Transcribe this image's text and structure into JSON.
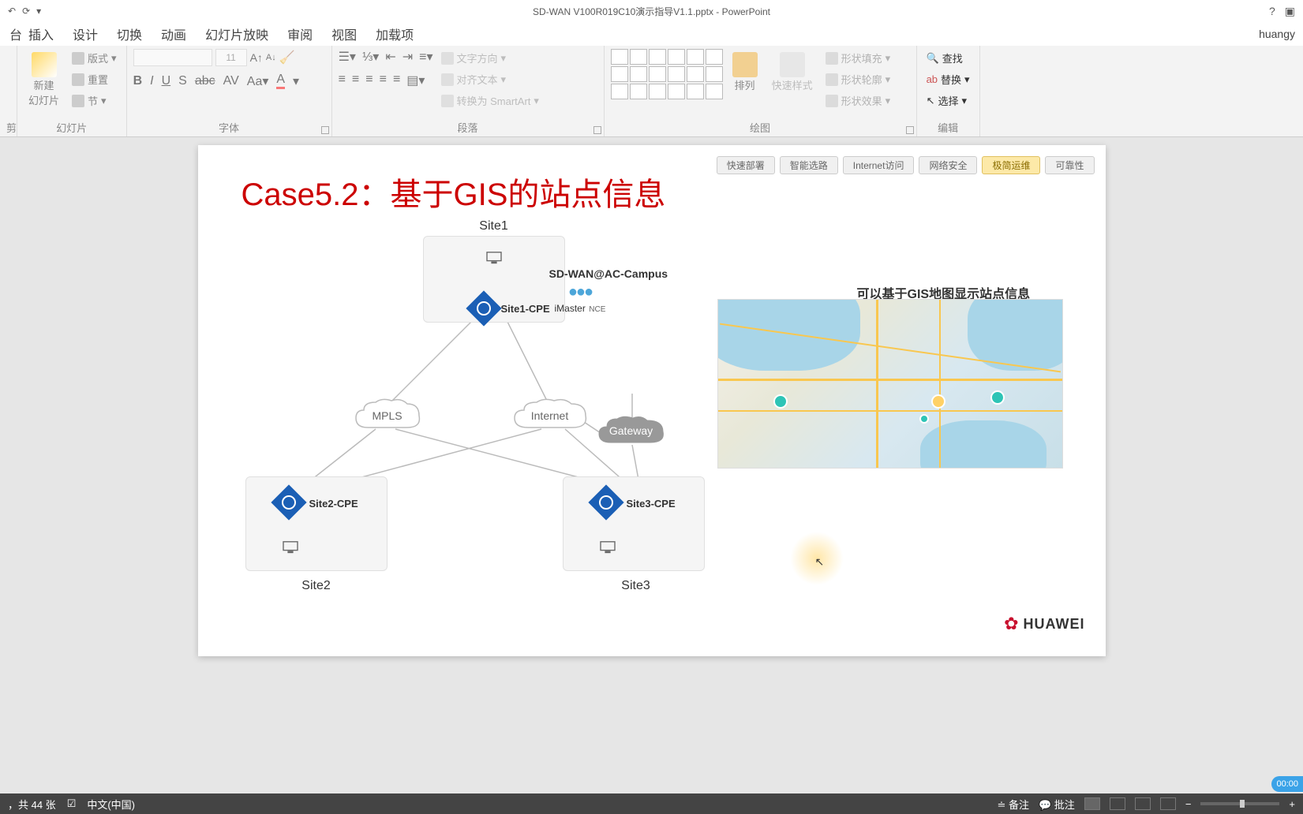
{
  "title_bar": {
    "document_title": "SD-WAN V100R019C10演示指导V1.1.pptx - PowerPoint",
    "help_icon": "?"
  },
  "ribbon_tabs": {
    "start_edge": "台",
    "items": [
      "插入",
      "设计",
      "切换",
      "动画",
      "幻灯片放映",
      "审阅",
      "视图",
      "加载项"
    ],
    "user": "huangy"
  },
  "ribbon": {
    "clipboard": {
      "label": "剪"
    },
    "slides": {
      "new_slide": "新建\n幻灯片",
      "layout": "版式",
      "reset": "重置",
      "section": "节",
      "group_label": "幻灯片"
    },
    "font": {
      "size_value": "11",
      "buttons": [
        "B",
        "I",
        "U",
        "S"
      ],
      "group_label": "字体"
    },
    "paragraph": {
      "text_direction": "文字方向",
      "align_text": "对齐文本",
      "convert_smartart": "转换为 SmartArt",
      "group_label": "段落"
    },
    "drawing": {
      "arrange": "排列",
      "quick_styles": "快速样式",
      "shape_fill": "形状填充",
      "shape_outline": "形状轮廓",
      "shape_effects": "形状效果",
      "group_label": "绘图"
    },
    "editing": {
      "find": "查找",
      "replace": "替换",
      "select": "选择",
      "group_label": "编辑"
    }
  },
  "slide": {
    "title": "Case5.2：基于GIS的站点信息",
    "nav_pills": [
      {
        "label": "快速部署",
        "active": false
      },
      {
        "label": "智能选路",
        "active": false
      },
      {
        "label": "Internet访问",
        "active": false
      },
      {
        "label": "网络安全",
        "active": false
      },
      {
        "label": "极简运维",
        "active": true
      },
      {
        "label": "可靠性",
        "active": false
      }
    ],
    "diagram": {
      "site1_label": "Site1",
      "site2_label": "Site2",
      "site3_label": "Site3",
      "site1_cpe": "Site1-CPE",
      "site2_cpe": "Site2-CPE",
      "site3_cpe": "Site3-CPE",
      "mpls": "MPLS",
      "internet": "Internet",
      "gateway": "Gateway",
      "sdwan_label": "SD-WAN@AC-Campus",
      "imaster_label": "iMaster",
      "nce_label": "NCE"
    },
    "map_title": "可以基于GIS地图显示站点信息",
    "huawei_brand": "HUAWEI"
  },
  "status_bar": {
    "slide_count": "，共 44 张",
    "language": "中文(中国)",
    "notes": "备注",
    "comments": "批注",
    "time": "00:00"
  }
}
